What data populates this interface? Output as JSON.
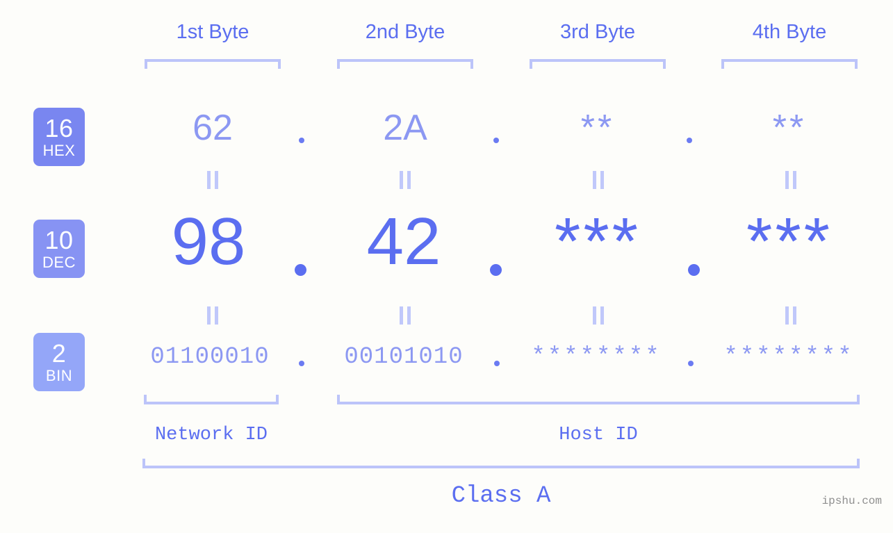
{
  "background_color": "#fdfdfa",
  "accent_color": "#5b6ef0",
  "accent_light_color": "#8c98f2",
  "bracket_color": "#bcc4f9",
  "headers": [
    {
      "label": "1st Byte"
    },
    {
      "label": "2nd Byte"
    },
    {
      "label": "3rd Byte"
    },
    {
      "label": "4th Byte"
    }
  ],
  "bases": [
    {
      "number": "16",
      "name": "HEX",
      "color": "#7986f0"
    },
    {
      "number": "10",
      "name": "DEC",
      "color": "#8793f3"
    },
    {
      "number": "2",
      "name": "BIN",
      "color": "#94a6f8"
    }
  ],
  "rows": {
    "hex": {
      "base_number": "16",
      "base_name": "HEX",
      "values": [
        "62",
        "2A",
        "**",
        "**"
      ],
      "separator": "."
    },
    "dec": {
      "base_number": "10",
      "base_name": "DEC",
      "values": [
        "98",
        "42",
        "***",
        "***"
      ],
      "separator": "."
    },
    "bin": {
      "base_number": "2",
      "base_name": "BIN",
      "values": [
        "01100010",
        "00101010",
        "********",
        "********"
      ],
      "separator": "."
    }
  },
  "equals_symbol": "=",
  "segments": {
    "network_id": "Network ID",
    "host_id": "Host ID",
    "class": "Class A"
  },
  "watermark": "ipshu.com"
}
